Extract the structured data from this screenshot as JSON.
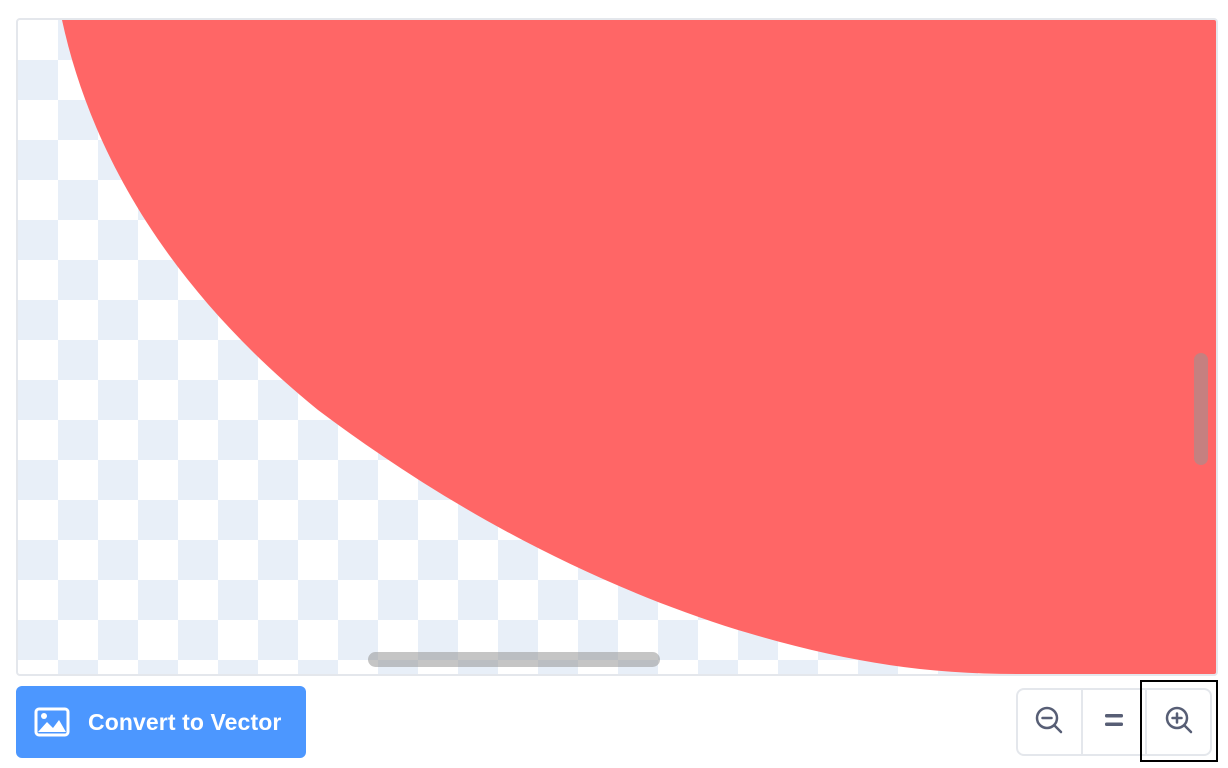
{
  "canvas": {
    "background": "transparency-checkerboard",
    "shape_fill": "#ff6666",
    "checker_color": "#e8eff8"
  },
  "convert_button": {
    "label": "Convert to Vector",
    "icon": "image-icon",
    "color": "#4c97ff"
  },
  "zoom_controls": {
    "zoom_out_icon": "zoom-out-icon",
    "reset_icon": "equals-icon",
    "zoom_in_icon": "zoom-in-icon",
    "focused": "zoom-in"
  }
}
